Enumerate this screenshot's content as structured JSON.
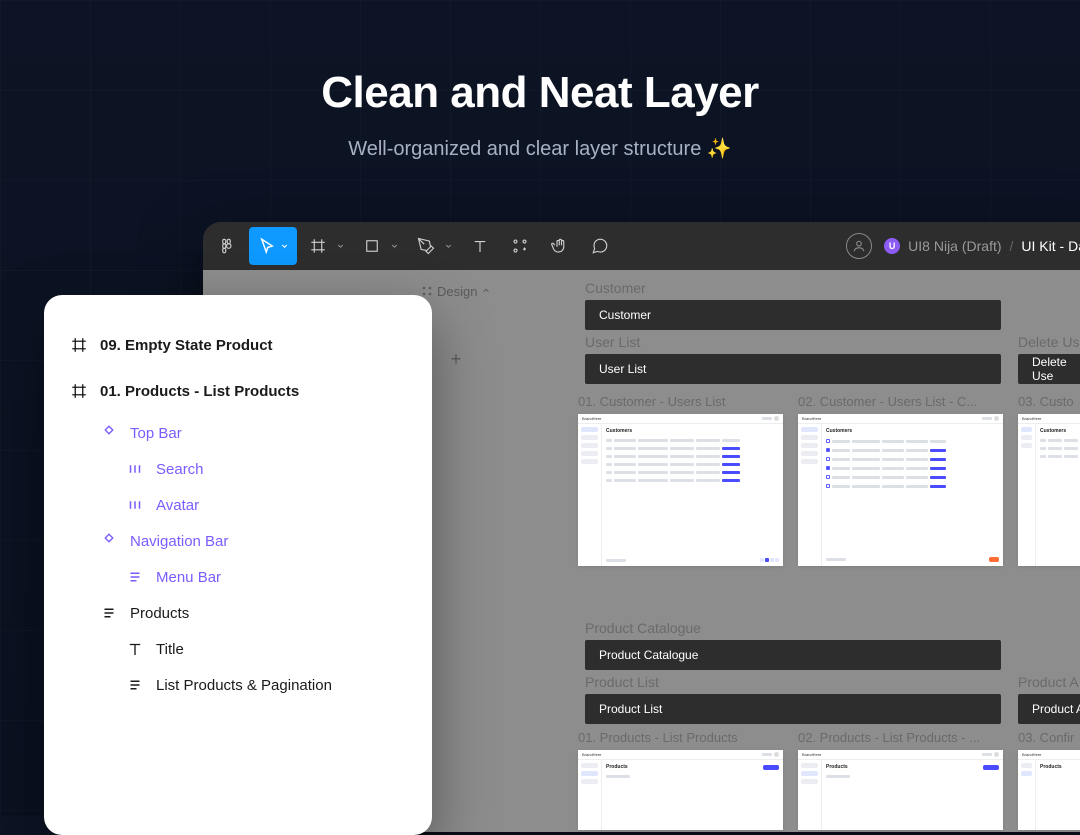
{
  "hero": {
    "title": "Clean and Neat Layer",
    "subtitle": "Well-organized and clear layer structure ✨"
  },
  "toolbar": {
    "file_owner": "UI8 Nija (Draft)",
    "file_name": "UI Kit - Das",
    "design_tab": "Design"
  },
  "canvas": {
    "section_customer": "Customer",
    "bar_customer": "Customer",
    "section_userlist": "User List",
    "bar_userlist": "User List",
    "section_deleteuser": "Delete Us",
    "bar_deleteuser": "Delete Use",
    "frame_01": "01. Customer - Users List",
    "frame_02": "02. Customer - Users List - C...",
    "frame_03": "03. Custo",
    "section_product_catalogue": "Product Catalogue",
    "bar_product_catalogue": "Product Catalogue",
    "section_productlist": "Product List",
    "bar_productlist": "Product List",
    "section_producta": "Product A",
    "bar_producta": "Product A",
    "frame_p01": "01. Products - List Products",
    "frame_p02": "02. Products - List Products - ...",
    "frame_p03": "03. Confir",
    "mini_brand": "BrandHere",
    "mini_title_customers": "Customers",
    "mini_title_products": "Products"
  },
  "layers": {
    "item_0": "09. Empty State Product",
    "item_1": "01. Products - List Products",
    "item_2": "Top Bar",
    "item_3": "Search",
    "item_4": "Avatar",
    "item_5": "Navigation Bar",
    "item_6": "Menu Bar",
    "item_7": "Products",
    "item_8": "Title",
    "item_9": "List Products & Pagination"
  }
}
